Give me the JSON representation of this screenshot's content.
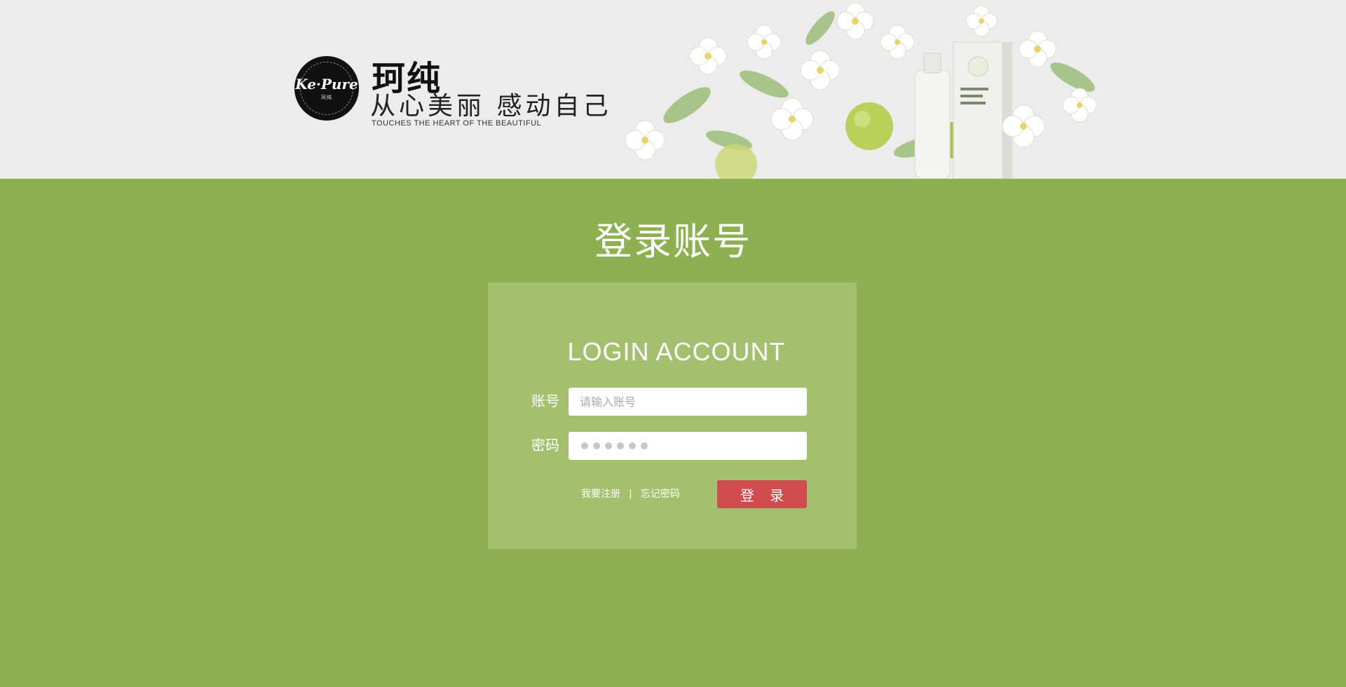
{
  "header": {
    "logo_text": "Ke·Pure",
    "logo_subtext": "珂纯",
    "brand_name": "珂纯",
    "slogan": "从心美丽 感动自己",
    "slogan_en": "TOUCHES THE HEART OF THE BEAUTIFUL"
  },
  "main": {
    "title": "登录账号",
    "panel_title": "LOGIN ACCOUNT",
    "account_label": "账号",
    "account_placeholder": "请输入账号",
    "password_label": "密码",
    "register_link": "我要注册",
    "separator": "|",
    "forgot_link": "忘记密码",
    "login_button": "登 录"
  },
  "colors": {
    "page_bg": "#8db150",
    "header_bg": "#ececec",
    "panel_bg": "#a3c06f",
    "button_bg": "#d04b4d"
  },
  "icons": [
    "brand-logo",
    "floral-product-illustration"
  ]
}
